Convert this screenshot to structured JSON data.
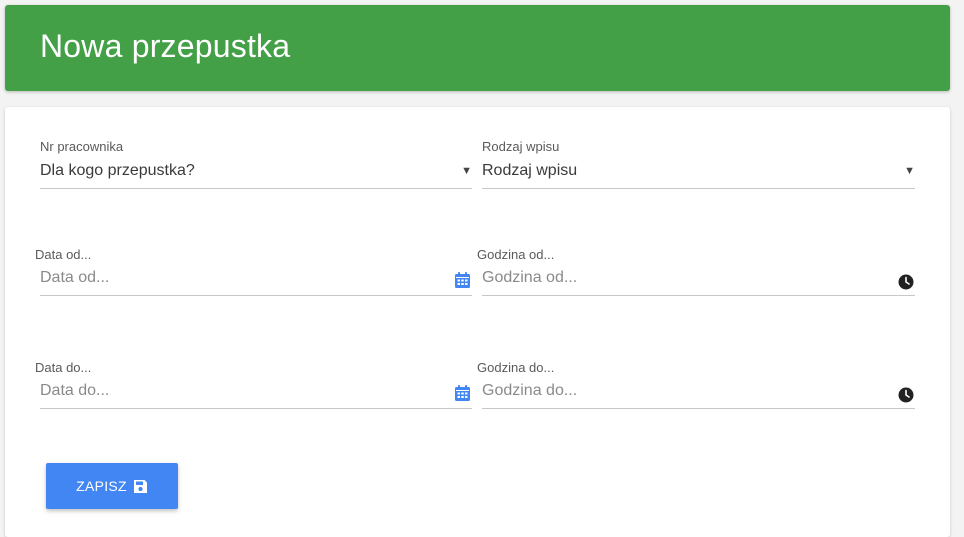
{
  "header": {
    "title": "Nowa przepustka"
  },
  "form": {
    "employee": {
      "label": "Nr pracownika",
      "placeholder": "Dla kogo przepustka?"
    },
    "entry_type": {
      "label": "Rodzaj wpisu",
      "placeholder": "Rodzaj wpisu"
    },
    "date_from": {
      "label": "Data od...",
      "placeholder": "Data od..."
    },
    "time_from": {
      "label": "Godzina od...",
      "placeholder": "Godzina od..."
    },
    "date_to": {
      "label": "Data do...",
      "placeholder": "Data do..."
    },
    "time_to": {
      "label": "Godzina do...",
      "placeholder": "Godzina do..."
    }
  },
  "actions": {
    "save_label": "ZAPISZ"
  },
  "icons": {
    "dropdown": "caret-down-icon",
    "date": "calendar-icon",
    "time": "clock-icon",
    "save": "floppy-disk-icon"
  },
  "colors": {
    "header_bg": "#43a047",
    "button_bg": "#4286f4",
    "calendar_icon": "#4286f4",
    "clock_icon": "#222222"
  }
}
